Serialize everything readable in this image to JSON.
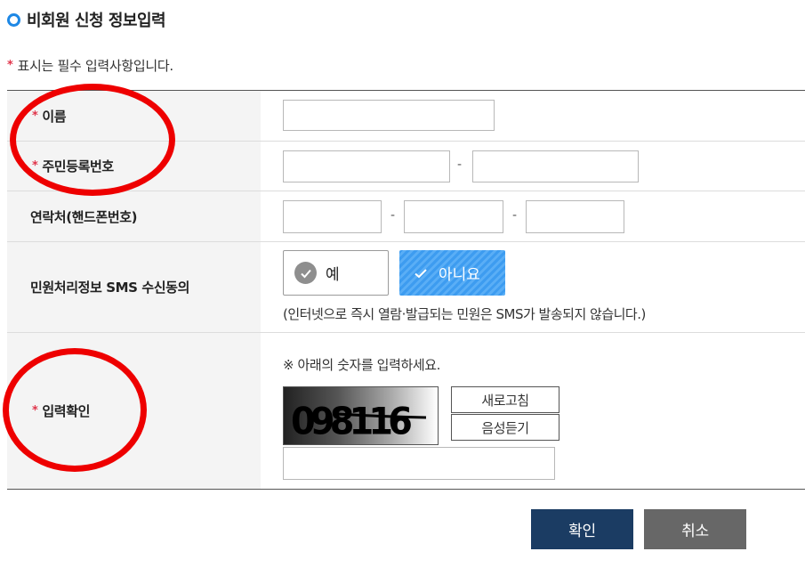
{
  "page": {
    "title": "비회원 신청 정보입력",
    "required_notice": "표시는 필수 입력사항입니다.",
    "required_mark": "*"
  },
  "form": {
    "name_label": "이름",
    "rrn_label": "주민등록번호",
    "rrn_sep": "-",
    "phone_label": "연락처(핸드폰번호)",
    "phone_sep1": "-",
    "phone_sep2": "-",
    "sms_label": "민원처리정보 SMS 수신동의",
    "sms_yes": "예",
    "sms_no": "아니요",
    "sms_selected": "아니요",
    "sms_note": "(인터넷으로 즉시 열람·발급되는 민원은 SMS가 발송되지 않습니다.)",
    "captcha_label": "입력확인",
    "captcha_note": "※ 아래의 숫자를 입력하세요.",
    "captcha_text": "098116",
    "refresh_label": "새로고침",
    "audio_label": "음성듣기"
  },
  "actions": {
    "confirm": "확인",
    "cancel": "취소"
  },
  "colors": {
    "title_dot": "#1e88e5",
    "required_mark": "#e0344a",
    "selected_option": "#3d9cf0",
    "confirm_button": "#1b3c63",
    "cancel_button": "#676767",
    "annotation": "#ee0000"
  }
}
